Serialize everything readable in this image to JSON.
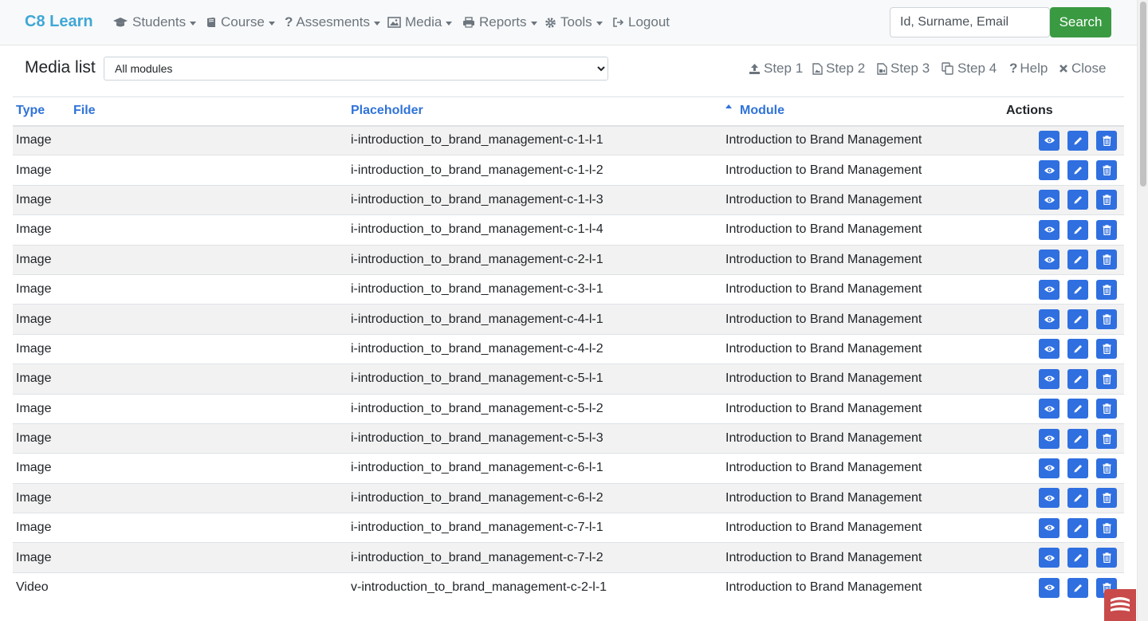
{
  "nav": {
    "brand": "C8 Learn",
    "items": [
      {
        "label": "Students",
        "icon": "graduation-cap-icon",
        "dropdown": true
      },
      {
        "label": "Course",
        "icon": "book-icon",
        "dropdown": true
      },
      {
        "label": "Assesments",
        "icon": "question-icon",
        "dropdown": true
      },
      {
        "label": "Media",
        "icon": "image-icon",
        "dropdown": true
      },
      {
        "label": "Reports",
        "icon": "printer-icon",
        "dropdown": true
      },
      {
        "label": "Tools",
        "icon": "gear-icon",
        "dropdown": true
      },
      {
        "label": "Logout",
        "icon": "sign-out-icon",
        "dropdown": false
      }
    ],
    "search_placeholder": "Id, Surname, Email",
    "search_label": "Search"
  },
  "toolbar": {
    "title": "Media list",
    "module_selected": "All modules",
    "steps": [
      {
        "label": "Step 1",
        "icon": "upload-icon"
      },
      {
        "label": "Step 2",
        "icon": "file-image-icon"
      },
      {
        "label": "Step 3",
        "icon": "file-video-icon"
      },
      {
        "label": "Step 4",
        "icon": "copy-icon"
      },
      {
        "label": "Help",
        "icon": "question-icon"
      },
      {
        "label": "Close",
        "icon": "close-icon"
      }
    ]
  },
  "table": {
    "headers": {
      "type": "Type",
      "file": "File",
      "placeholder": "Placeholder",
      "module": "Module",
      "actions": "Actions"
    },
    "sorted_column": "module",
    "rows": [
      {
        "type": "Image",
        "file": "",
        "placeholder": "i-introduction_to_brand_management-c-1-l-1",
        "module": "Introduction to Brand Management"
      },
      {
        "type": "Image",
        "file": "",
        "placeholder": "i-introduction_to_brand_management-c-1-l-2",
        "module": "Introduction to Brand Management"
      },
      {
        "type": "Image",
        "file": "",
        "placeholder": "i-introduction_to_brand_management-c-1-l-3",
        "module": "Introduction to Brand Management"
      },
      {
        "type": "Image",
        "file": "",
        "placeholder": "i-introduction_to_brand_management-c-1-l-4",
        "module": "Introduction to Brand Management"
      },
      {
        "type": "Image",
        "file": "",
        "placeholder": "i-introduction_to_brand_management-c-2-l-1",
        "module": "Introduction to Brand Management"
      },
      {
        "type": "Image",
        "file": "",
        "placeholder": "i-introduction_to_brand_management-c-3-l-1",
        "module": "Introduction to Brand Management"
      },
      {
        "type": "Image",
        "file": "",
        "placeholder": "i-introduction_to_brand_management-c-4-l-1",
        "module": "Introduction to Brand Management"
      },
      {
        "type": "Image",
        "file": "",
        "placeholder": "i-introduction_to_brand_management-c-4-l-2",
        "module": "Introduction to Brand Management"
      },
      {
        "type": "Image",
        "file": "",
        "placeholder": "i-introduction_to_brand_management-c-5-l-1",
        "module": "Introduction to Brand Management"
      },
      {
        "type": "Image",
        "file": "",
        "placeholder": "i-introduction_to_brand_management-c-5-l-2",
        "module": "Introduction to Brand Management"
      },
      {
        "type": "Image",
        "file": "",
        "placeholder": "i-introduction_to_brand_management-c-5-l-3",
        "module": "Introduction to Brand Management"
      },
      {
        "type": "Image",
        "file": "",
        "placeholder": "i-introduction_to_brand_management-c-6-l-1",
        "module": "Introduction to Brand Management"
      },
      {
        "type": "Image",
        "file": "",
        "placeholder": "i-introduction_to_brand_management-c-6-l-2",
        "module": "Introduction to Brand Management"
      },
      {
        "type": "Image",
        "file": "",
        "placeholder": "i-introduction_to_brand_management-c-7-l-1",
        "module": "Introduction to Brand Management"
      },
      {
        "type": "Image",
        "file": "",
        "placeholder": "i-introduction_to_brand_management-c-7-l-2",
        "module": "Introduction to Brand Management"
      },
      {
        "type": "Video",
        "file": "",
        "placeholder": "v-introduction_to_brand_management-c-2-l-1",
        "module": "Introduction to Brand Management"
      }
    ]
  },
  "colors": {
    "brand": "#3fa7d6",
    "link": "#2f73d8",
    "action": "#2f6fe0",
    "search": "#3a9a42"
  }
}
